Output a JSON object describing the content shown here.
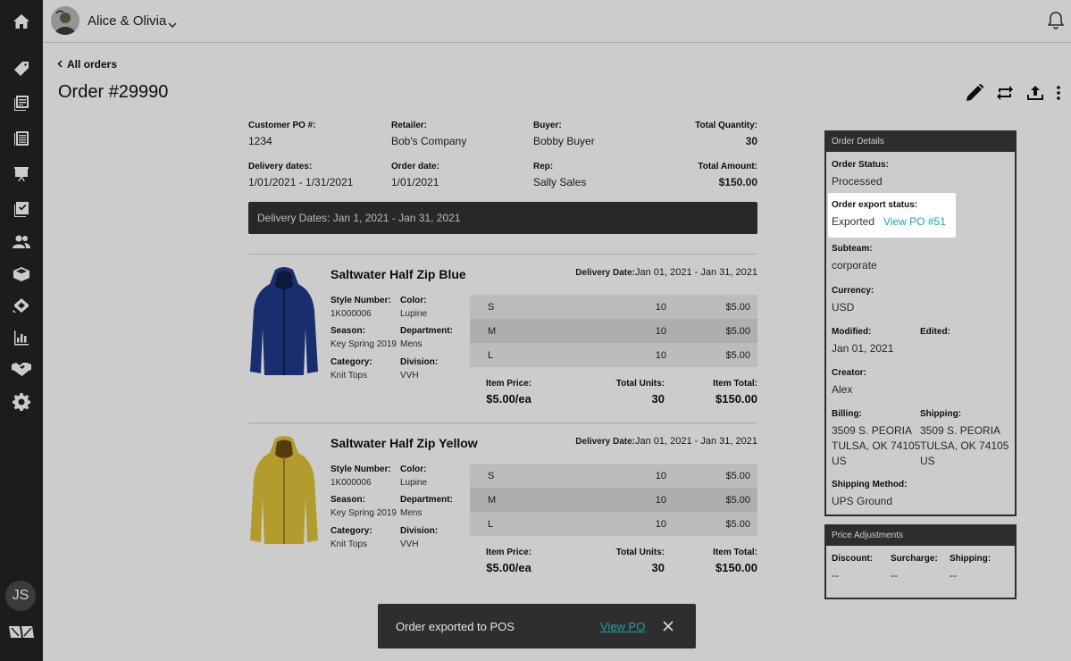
{
  "topbar": {
    "brand_name": "Alice & Olivia"
  },
  "sidebar": {
    "items": [
      "home-icon",
      "tag-icon",
      "catalog-icon",
      "linesheet-icon",
      "presentation-icon",
      "checklist-icon",
      "users-icon",
      "box-icon",
      "promotions-icon",
      "analytics-icon",
      "handshake-icon",
      "gear-icon"
    ],
    "user_initials": "JS"
  },
  "header": {
    "back_label": "All orders",
    "title": "Order #29990"
  },
  "summary": {
    "customer_po_label": "Customer PO #:",
    "customer_po": "1234",
    "retailer_label": "Retailer:",
    "retailer": "Bob's Company",
    "buyer_label": "Buyer:",
    "buyer": "Bobby Buyer",
    "total_qty_label": "Total Quantity:",
    "total_qty": "30",
    "delivery_dates_label": "Delivery dates:",
    "delivery_dates": "1/01/2021 - 1/31/2021",
    "order_date_label": "Order date:",
    "order_date": "1/01/2021",
    "rep_label": "Rep:",
    "rep": "Sally Sales",
    "total_amount_label": "Total Amount:",
    "total_amount": "$150.00"
  },
  "banner": {
    "text": "Delivery Dates: Jan 1, 2021 - Jan 31, 2021"
  },
  "products": [
    {
      "name": "Saltwater Half Zip Blue",
      "delivery_label": "Delivery Date:",
      "delivery": "Jan 01, 2021 - Jan 31, 2021",
      "style_label": "Style Number:",
      "style": "1K000006",
      "color_label": "Color:",
      "color": "Lupine",
      "season_label": "Season:",
      "season": "Key Spring 2019",
      "department_label": "Department:",
      "department": "Mens",
      "category_label": "Category:",
      "category": "Knit Tops",
      "division_label": "Division:",
      "division": "VVH",
      "sizes": [
        {
          "size": "S",
          "qty": "10",
          "price": "$5.00"
        },
        {
          "size": "M",
          "qty": "10",
          "price": "$5.00"
        },
        {
          "size": "L",
          "qty": "10",
          "price": "$5.00"
        }
      ],
      "item_price_label": "Item Price:",
      "item_price": "$5.00/ea",
      "total_units_label": "Total Units:",
      "total_units": "30",
      "item_total_label": "Item Total:",
      "item_total": "$150.00",
      "jacket_color": "#1f3a8a"
    },
    {
      "name": "Saltwater Half Zip Yellow",
      "delivery_label": "Delivery Date:",
      "delivery": "Jan 01, 2021 - Jan 31, 2021",
      "style_label": "Style Number:",
      "style": "1K000006",
      "color_label": "Color:",
      "color": "Lupine",
      "season_label": "Season:",
      "season": "Key Spring 2019",
      "department_label": "Department:",
      "department": "Mens",
      "category_label": "Category:",
      "category": "Knit Tops",
      "division_label": "Division:",
      "division": "VVH",
      "sizes": [
        {
          "size": "S",
          "qty": "10",
          "price": "$5.00"
        },
        {
          "size": "M",
          "qty": "10",
          "price": "$5.00"
        },
        {
          "size": "L",
          "qty": "10",
          "price": "$5.00"
        }
      ],
      "item_price_label": "Item Price:",
      "item_price": "$5.00/ea",
      "total_units_label": "Total Units:",
      "total_units": "30",
      "item_total_label": "Item Total:",
      "item_total": "$150.00",
      "jacket_color": "#e0c23a"
    }
  ],
  "order_details": {
    "title": "Order Details",
    "status_label": "Order Status:",
    "status": "Processed",
    "export_label": "Order export status:",
    "export_status": "Exported",
    "export_link": "View PO #51",
    "subteam_label": "Subteam:",
    "subteam": "corporate",
    "currency_label": "Currency:",
    "currency": "USD",
    "modified_label": "Modified:",
    "modified": "Jan 01, 2021",
    "edited_label": "Edited:",
    "creator_label": "Creator:",
    "creator": "Alex",
    "billing_label": "Billing:",
    "billing_line1": "3509 S. PEORIA",
    "billing_line2": "TULSA, OK 74105",
    "billing_line3": "US",
    "shipping_label": "Shipping:",
    "shipping_line1": "3509 S. PEORIA",
    "shipping_line2": "TULSA, OK 74105",
    "shipping_line3": "US",
    "ship_method_label": "Shipping Method:",
    "ship_method": "UPS Ground"
  },
  "price_adjustments": {
    "title": "Price Adjustments",
    "discount_label": "Discount:",
    "discount": "--",
    "surcharge_label": "Surcharge:",
    "surcharge": "--",
    "shipping_label": "Shipping:",
    "shipping": "--"
  },
  "toast": {
    "message": "Order exported to POS",
    "link": "View PO"
  },
  "colors": {
    "accent": "#1aa5a5",
    "sidebar": "#242424",
    "panel_header": "#3a3a3a"
  }
}
